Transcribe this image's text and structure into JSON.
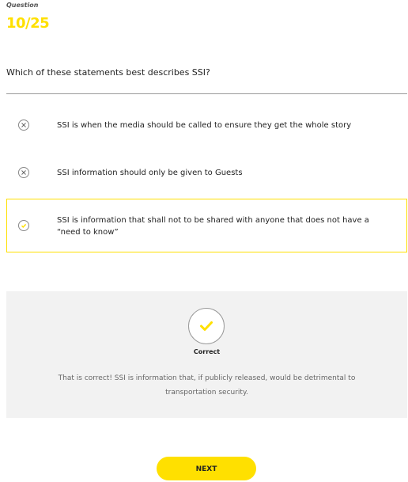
{
  "header": {
    "question_label": "Question",
    "counter": "10/25"
  },
  "question": {
    "text": "Which of these statements best describes SSI?"
  },
  "options": [
    {
      "text": "SSI is when the media should be called to ensure they get the whole story",
      "icon": "x-circle-icon",
      "state": "incorrect"
    },
    {
      "text": "SSI information should only be given to Guests",
      "icon": "x-circle-icon",
      "state": "incorrect"
    },
    {
      "text": "SSI is information that shall not to be shared with anyone that does not have a “need to know”",
      "icon": "check-circle-icon",
      "state": "selected-correct"
    }
  ],
  "feedback": {
    "icon": "check-icon",
    "title": "Correct",
    "body": "That is correct! SSI is information that, if publicly released, would be detrimental to transportation security."
  },
  "actions": {
    "next_label": "NEXT"
  },
  "colors": {
    "accent": "#ffe000",
    "feedback_bg": "#f2f2f2",
    "text": "#222222",
    "muted": "#666666"
  }
}
